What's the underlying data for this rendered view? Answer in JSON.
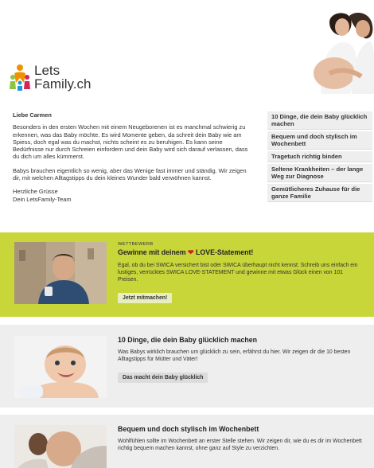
{
  "logo": {
    "line1": "Lets",
    "line2": "Family.ch"
  },
  "letter": {
    "greeting": "Liebe Carmen",
    "p1": "Besonders in den ersten Wochen mit einem Neugeborenen ist es manchmal schwierig zu erkennen, was das Baby möchte. Es wird Momente geben, da schreit dein Baby wie am Spiess, doch egal was du machst, nichts scheint es zu beruhigen. Es kann seine Bedürfnisse nur durch Schreien einfordern und dein Baby wird sich darauf verlassen, dass du dich um alles kümmerst.",
    "p2": "Babys brauchen eigentlich so wenig, aber das Wenige fast immer und ständig. Wir zeigen dir, mit welchen Alltagstipps du dein kleines Wunder bald verwöhnen kannst.",
    "closing": "Herzliche Grüsse",
    "signature": "Dein LetsFamily-Team"
  },
  "sidenav": [
    "10 Dinge, die dein Baby glücklich machen",
    "Bequem und doch stylisch im Wochenbett",
    "Tragetuch richtig binden",
    "Seltene Krankheiten – der lange Weg zur Diagnose",
    "Gemütlicheres Zuhause für die ganze Familie"
  ],
  "cards": [
    {
      "eyebrow": "WETTBEWERB",
      "title_pre": "Gewinne mit deinem",
      "title_post": "LOVE-Statement!",
      "body": "Egal, ob du bei SWICA versichert bist oder SWICA überhaupt nicht kennst: Schreib uns einfach ein lustiges, verrücktes SWICA LOVE-STATEMENT und gewinne mit etwas Glück einen von 101 Preisen.",
      "button": "Jetzt mitmachen!"
    },
    {
      "title": "10 Dinge, die dein Baby glücklich machen",
      "body": "Was Babys wirklich brauchen um glücklich zu sein, erfährst du hier. Wir zeigen dir die 10 besten Alltagstipps für Mütter und Väter!",
      "button": "Das macht dein Baby glücklich"
    },
    {
      "title": "Bequem und doch stylisch im Wochenbett",
      "body": "Wohlfühlen sollte im Wochenbett an erster Stelle stehen. Wir zeigen dir, wie du es dir im Wochenbett richtig bequem machen kannst, ohne ganz auf Style zu verzichten."
    }
  ],
  "colors": {
    "accent": "#c9d63a",
    "heart": "#d81e1e",
    "panel": "#eeeeee"
  }
}
